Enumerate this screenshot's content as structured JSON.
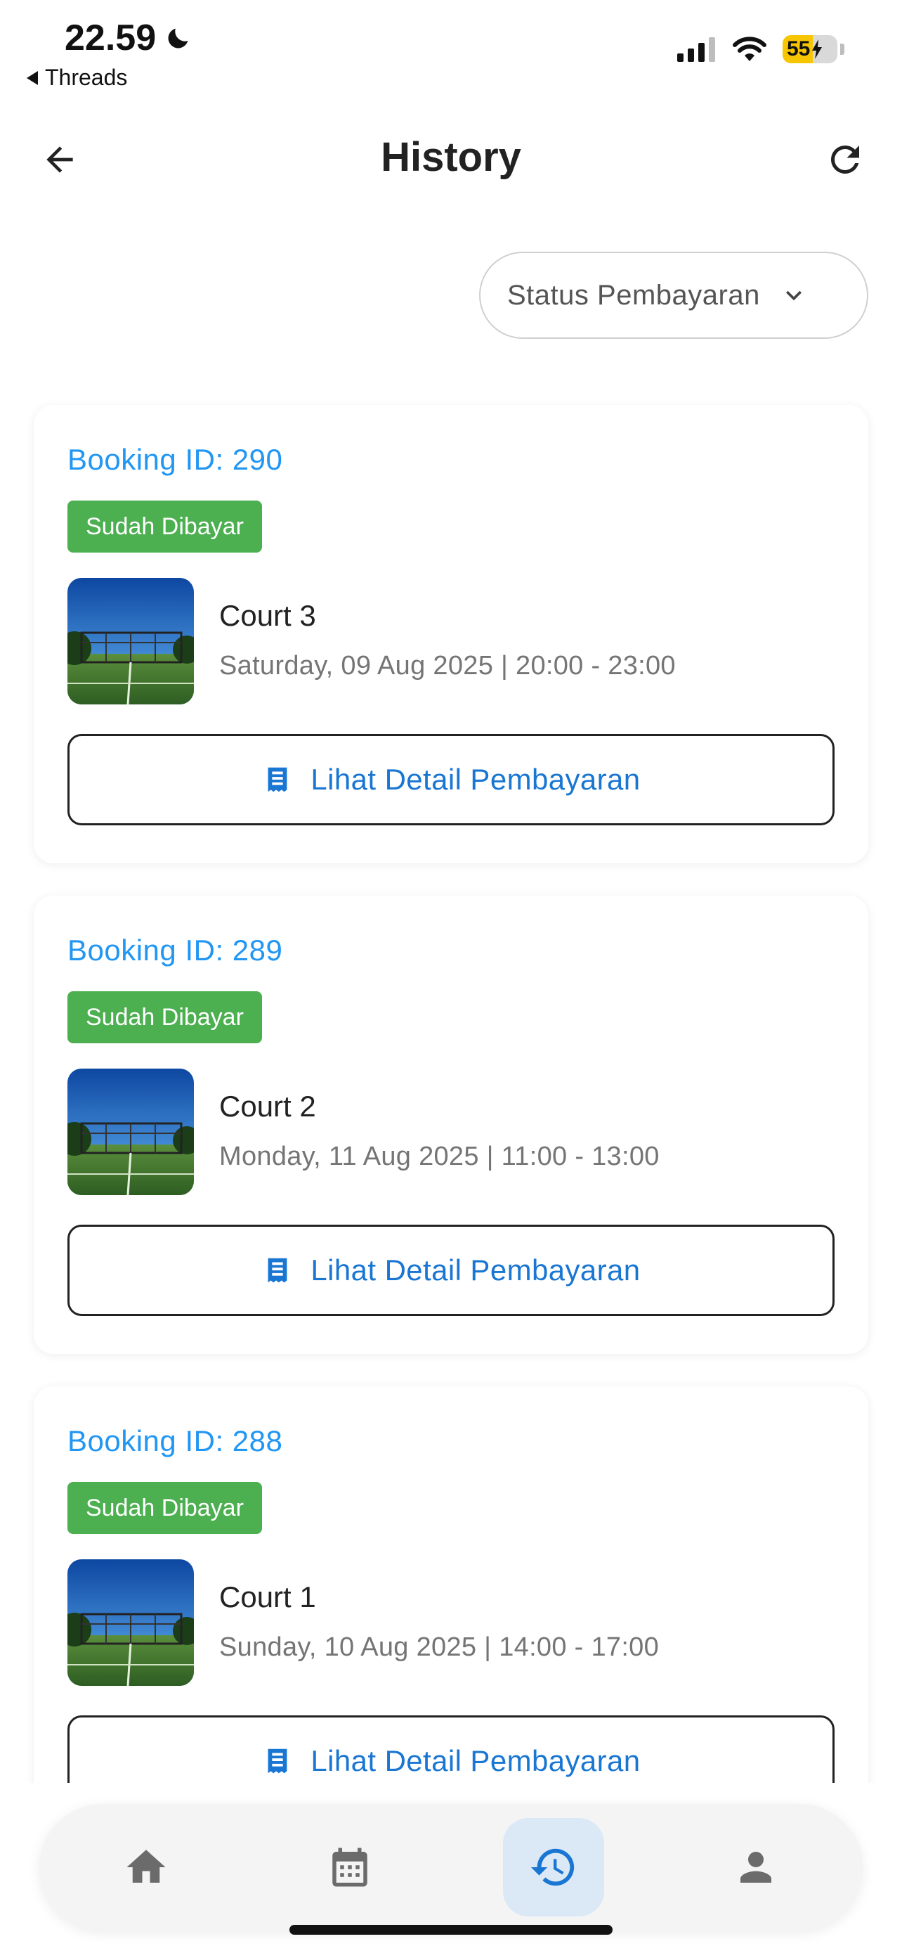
{
  "status_bar": {
    "time": "22.59",
    "back_app": "Threads",
    "battery": "55"
  },
  "app_bar": {
    "title": "History"
  },
  "filter": {
    "label": "Status Pembayaran"
  },
  "bookings": [
    {
      "booking_id": "Booking ID: 290",
      "status": "Sudah Dibayar",
      "court": "Court 3",
      "schedule": "Saturday, 09 Aug 2025 | 20:00 - 23:00",
      "action": "Lihat Detail Pembayaran"
    },
    {
      "booking_id": "Booking ID: 289",
      "status": "Sudah Dibayar",
      "court": "Court 2",
      "schedule": "Monday, 11 Aug 2025 | 11:00 - 13:00",
      "action": "Lihat Detail Pembayaran"
    },
    {
      "booking_id": "Booking ID: 288",
      "status": "Sudah Dibayar",
      "court": "Court 1",
      "schedule": "Sunday, 10 Aug 2025 | 14:00 - 17:00",
      "action": "Lihat Detail Pembayaran"
    }
  ],
  "bottom_nav": {
    "items": [
      "home-icon",
      "calendar-icon",
      "history-icon",
      "person-icon"
    ],
    "active": "history-icon"
  },
  "colors": {
    "accent": "#2196f3",
    "button_text": "#1976d2",
    "paid_badge": "#4caf50",
    "nav_active_bg": "#dbe8f6",
    "battery": "#f7c600"
  }
}
